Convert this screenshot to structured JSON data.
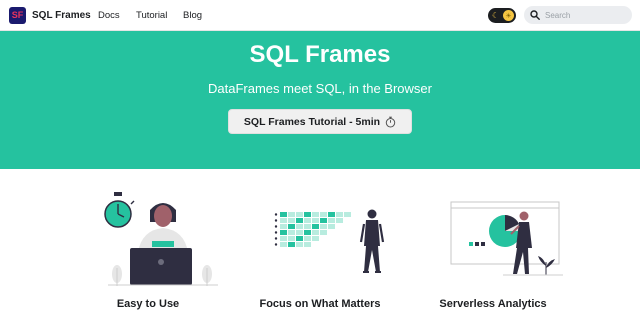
{
  "navbar": {
    "brand_logo_text": "SF",
    "brand_title": "SQL Frames",
    "links": [
      "Docs",
      "Tutorial",
      "Blog"
    ],
    "search_placeholder": "Search",
    "theme_toggle_icon": "sun-icon"
  },
  "hero": {
    "title": "SQL Frames",
    "subtitle": "DataFrames meet SQL, in the Browser",
    "button_label": "SQL Frames Tutorial - 5min",
    "button_icon": "stopwatch-icon"
  },
  "features": [
    {
      "title": "Easy to Use",
      "illustration": "person-laptop-stopwatch-illustration"
    },
    {
      "title": "Focus on What Matters",
      "illustration": "person-data-grid-illustration"
    },
    {
      "title": "Serverless Analytics",
      "illustration": "person-dashboard-pie-chart-illustration"
    }
  ],
  "colors": {
    "hero_bg": "#25c29f",
    "accent": "#25c29f",
    "text": "#1c1e21",
    "brand_logo_bg": "#1a1a6e",
    "brand_logo_text": "#e8335d"
  }
}
